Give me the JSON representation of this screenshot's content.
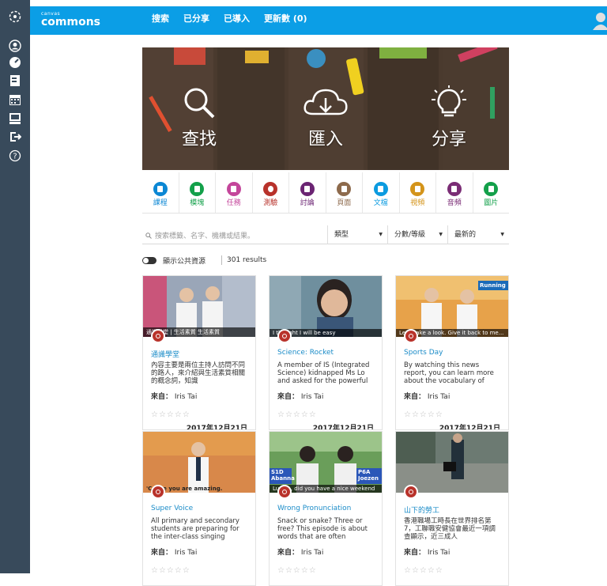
{
  "brand": {
    "small": "canvas",
    "name": "commons"
  },
  "nav": [
    {
      "label": "搜索",
      "active": true
    },
    {
      "label": "已分享",
      "active": false
    },
    {
      "label": "已導入",
      "active": false
    },
    {
      "label": "更新數 (0)",
      "active": false
    }
  ],
  "sidebar": [
    "logo-icon",
    "account-icon",
    "dashboard-icon",
    "courses-icon",
    "calendar-icon",
    "inbox-icon",
    "commons-icon",
    "help-icon"
  ],
  "hero": {
    "find": "查找",
    "import": "匯入",
    "share": "分享"
  },
  "types": [
    {
      "label": "課程",
      "color": "#0b87d4"
    },
    {
      "label": "模塊",
      "color": "#13a04a"
    },
    {
      "label": "任務",
      "color": "#c4469b"
    },
    {
      "label": "測驗",
      "color": "#b8322b"
    },
    {
      "label": "討論",
      "color": "#6b2473"
    },
    {
      "label": "頁面",
      "color": "#8d6a4c"
    },
    {
      "label": "文檔",
      "color": "#0b9be0"
    },
    {
      "label": "視頻",
      "color": "#d4941a"
    },
    {
      "label": "音頻",
      "color": "#7a2c75"
    },
    {
      "label": "圖片",
      "color": "#13a04a"
    }
  ],
  "filter": {
    "search_placeholder": "搜索標籤、名字、機構或結果。",
    "type_label": "類型",
    "grade_label": "分數/等級",
    "sort_label": "最新的"
  },
  "toggle_label": "顯示公共資源",
  "results": "301 results",
  "from_label": "來自：",
  "cards": [
    {
      "title": "通識學堂",
      "desc": "內容主要是兩位主持人訪問不同的路人，來介紹與生活素質相關的概念詞，知識",
      "author": "Iris Tai",
      "date": "2017年12月21日",
      "caption": "通識學堂 | 生活素質 生活素質",
      "stars": "☆☆☆☆☆"
    },
    {
      "title": "Science: Rocket",
      "desc": "A member of IS (Integrated Science) kidnapped Ms Lo and asked for the powerful",
      "author": "Iris Tai",
      "date": "2017年12月21日",
      "caption": "I thought I will be easy",
      "stars": "☆☆☆☆☆"
    },
    {
      "title": "Sports Day",
      "desc": "By watching this news report, you can learn more about the vocabulary of",
      "author": "Iris Tai",
      "date": "2017年12月21日",
      "caption": "Let's take a look. Give it back to me...",
      "badge": "Running",
      "stars": "☆☆☆☆☆"
    },
    {
      "title": "Super Voice",
      "desc": "All primary and secondary students are preparing for the inter-class singing",
      "author": "Iris Tai",
      "date": "",
      "caption": "'Cause you are amazing.",
      "stars": "☆☆☆☆☆"
    },
    {
      "title": "Wrong Pronunciation",
      "desc": "Snack or snake? Three or free? This episode is about words that are often",
      "author": "Iris Tai",
      "date": "",
      "caption": "Lucien, did you have a nice weekend",
      "tag1": "S1D Abanna",
      "tag2": "P6A Joezen",
      "stars": "☆☆☆☆☆"
    },
    {
      "title": "山下的勞工",
      "desc": "香港職場工時長在世界排名第7，工聯職安健協會最近一項調查顯示，近三成人",
      "author": "Iris Tai",
      "date": "",
      "caption": "",
      "stars": "☆☆☆☆☆"
    }
  ]
}
